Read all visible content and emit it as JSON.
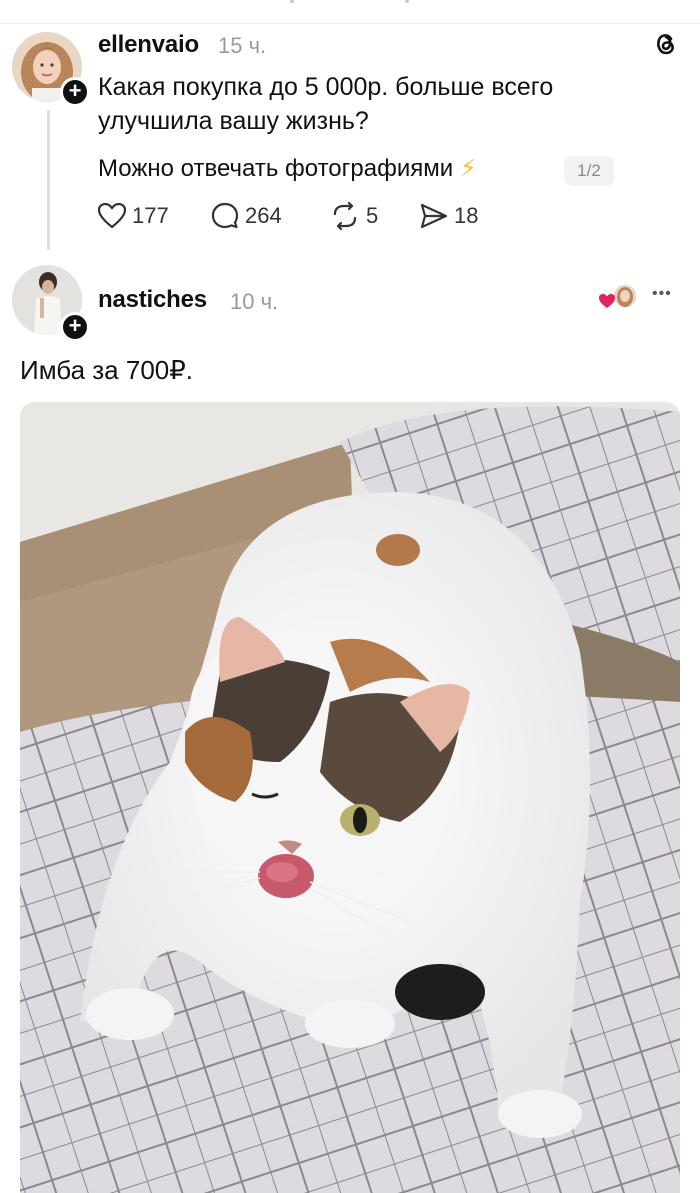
{
  "original_post": {
    "username": "ellenvaio",
    "time": "15 ч.",
    "text_line1": "Какая покупка до 5 000р. больше всего",
    "text_line2": "улучшила вашу жизнь?",
    "text_line3": "Можно отвечать фотографиями",
    "lightning_emoji": "⚡",
    "page_indicator": "1/2",
    "likes": "177",
    "comments": "264",
    "reposts": "5",
    "shares": "18"
  },
  "reply": {
    "username": "nastiches",
    "time": "10 ч.",
    "text": "Имба за 700₽.",
    "more_label": "•••",
    "photo_description_icon": "photo-of-calico-cat"
  },
  "colors": {
    "text": "#111111",
    "muted": "#9a9a9a",
    "heart": "#e0245e"
  }
}
